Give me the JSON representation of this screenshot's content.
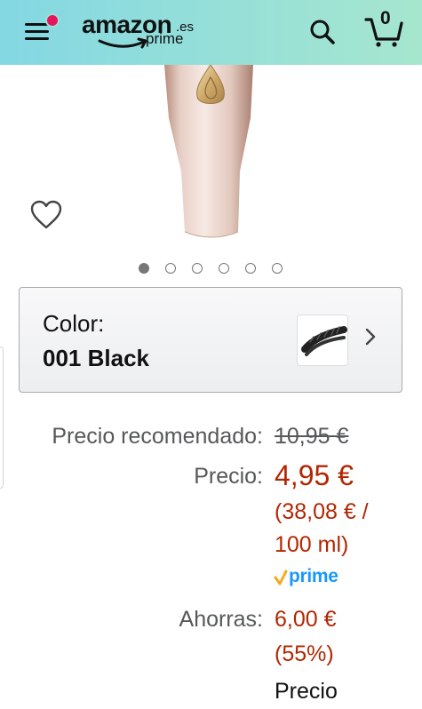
{
  "header": {
    "logo_text": "amazon",
    "logo_tld": ".es",
    "logo_sub": "prime",
    "cart_count": "0",
    "icons": [
      "menu-icon",
      "notification-dot",
      "search-icon",
      "cart-icon"
    ],
    "colors": {
      "gradient_start": "#84d8e3",
      "gradient_end": "#a6e6ce",
      "notification": "#e3165b"
    }
  },
  "product": {
    "icons": [
      "heart-icon"
    ],
    "carousel": {
      "total_images": 6,
      "active_index": 0
    }
  },
  "color_selector": {
    "label": "Color:",
    "value": "001 Black",
    "icons": [
      "mascara-swatch",
      "chevron-right-icon"
    ]
  },
  "pricing": {
    "recommended_label": "Precio recomendado:",
    "recommended_value": "10,95 €",
    "price_label": "Precio:",
    "price_value": "4,95 €",
    "unit_price_line1": "(38,08 € /",
    "unit_price_line2": "100 ml)",
    "prime_label": "prime",
    "savings_label": "Ahorras:",
    "savings_value": "6,00 €",
    "savings_percent": "(55%)",
    "next_label": "Precio",
    "colors": {
      "price": "#b12704",
      "label": "#565959",
      "prime": "#1a98ff",
      "prime_check": "#f7a823"
    }
  }
}
